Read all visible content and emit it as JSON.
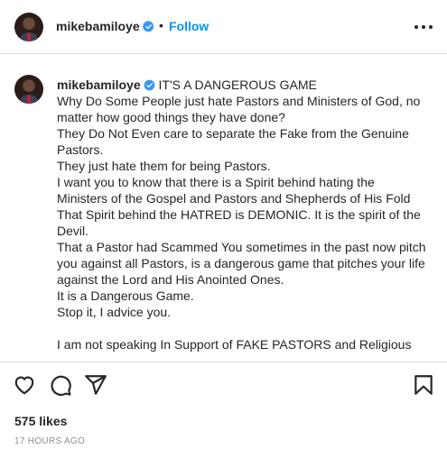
{
  "header": {
    "username": "mikebamiloye",
    "separator": "•",
    "follow_label": "Follow"
  },
  "caption": {
    "username": "mikebamiloye",
    "title": "IT'S A DANGEROUS GAME",
    "lines": [
      "Why Do Some People just hate Pastors and Ministers of God, no matter how good things they have done?",
      "They Do Not Even care to separate the Fake from the Genuine Pastors.",
      "They just hate them for being Pastors.",
      "I want you to know that there is a Spirit behind hating the Ministers of the Gospel and Pastors and Shepherds of His Fold",
      "That Spirit behind the HATRED is DEMONIC. It is the spirit of the Devil.",
      "That a Pastor had Scammed You sometimes in the past now pitch you against all Pastors, is a dangerous game that pitches your life against the Lord and His Anointed Ones.",
      "It is a Dangerous Game.",
      "Stop it, I advice you.",
      "",
      "I am not speaking In Support of FAKE PASTORS and Religious"
    ]
  },
  "actions": {
    "icons": [
      "heart-icon",
      "comment-icon",
      "share-icon",
      "bookmark-icon"
    ],
    "likes": "575 likes",
    "timestamp": "17 HOURS AGO"
  },
  "colors": {
    "link_blue": "#0095f6",
    "verified_blue": "#3897f0",
    "text": "#262626",
    "muted": "#8e8e8e",
    "divider": "#dbdbdb"
  }
}
